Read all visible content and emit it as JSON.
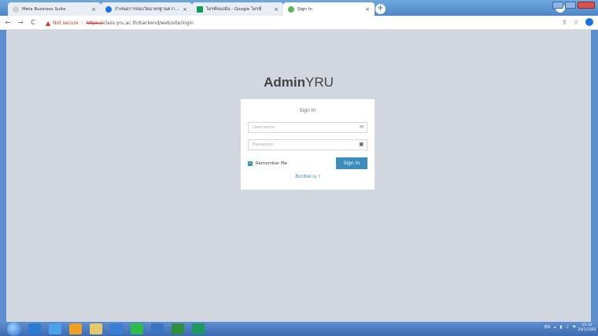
{
  "browser": {
    "tabs": [
      {
        "title": "Meta Business Suite",
        "icon_color": "#cfcfcf"
      },
      {
        "title": "กำหนดการสอบวัดมาตรฐานความ...",
        "icon_color": "#1a73e8"
      },
      {
        "title": "ไดรฟ์ของฉัน - Google ไดรฟ์",
        "icon_color": "#0f9d58"
      },
      {
        "title": "Sign In",
        "icon_color": "#5bb75b"
      }
    ],
    "new_tab_label": "+",
    "address": {
      "security_label": "Not secure",
      "separator": "|",
      "scheme": "https://",
      "rest": "class.yru.ac.th/backend/web/site/login"
    }
  },
  "page": {
    "logo_bold": "Admin",
    "logo_light": "YRU",
    "box_title": "Sign In",
    "username_placeholder": "Username",
    "password_placeholder": "Password",
    "remember_label": "Remember Me",
    "signin_button": "Sign In",
    "forgot_link": "ลืมรหัสผ่าน ?"
  },
  "taskbar": {
    "tray_lang": "EN",
    "clock_time": "15:33",
    "clock_date": "20/1/2565"
  },
  "colors": {
    "accent": "#3c8dbc",
    "page_bg": "#d2d6de",
    "warning": "#d93025"
  }
}
